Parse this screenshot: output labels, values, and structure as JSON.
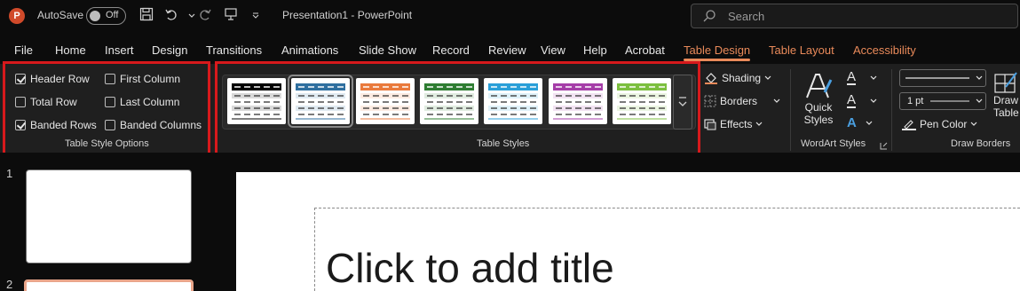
{
  "titlebar": {
    "app_logo": "P",
    "autosave_label": "AutoSave",
    "autosave_state": "Off",
    "doc_title": "Presentation1  -  PowerPoint",
    "search_placeholder": "Search"
  },
  "tabs": [
    {
      "label": "File"
    },
    {
      "label": "Home"
    },
    {
      "label": "Insert"
    },
    {
      "label": "Design"
    },
    {
      "label": "Transitions"
    },
    {
      "label": "Animations"
    },
    {
      "label": "Slide Show"
    },
    {
      "label": "Record"
    },
    {
      "label": "Review"
    },
    {
      "label": "View"
    },
    {
      "label": "Help"
    },
    {
      "label": "Acrobat"
    },
    {
      "label": "Table Design"
    },
    {
      "label": "Table Layout"
    },
    {
      "label": "Accessibility"
    }
  ],
  "table_style_options": {
    "caption": "Table Style Options",
    "options": [
      {
        "label": "Header Row",
        "checked": true
      },
      {
        "label": "First Column",
        "checked": false
      },
      {
        "label": "Total Row",
        "checked": false
      },
      {
        "label": "Last Column",
        "checked": false
      },
      {
        "label": "Banded Rows",
        "checked": true
      },
      {
        "label": "Banded Columns",
        "checked": false
      }
    ]
  },
  "table_styles": {
    "caption": "Table Styles",
    "styles": [
      {
        "accent": "#000000",
        "selected": false
      },
      {
        "accent": "#2f6f9f",
        "selected": true
      },
      {
        "accent": "#e97a3c",
        "selected": false
      },
      {
        "accent": "#2e7d32",
        "selected": false
      },
      {
        "accent": "#2a9fd8",
        "selected": false
      },
      {
        "accent": "#a53ea8",
        "selected": false
      },
      {
        "accent": "#7cbf3f",
        "selected": false
      }
    ]
  },
  "table_style_commands": {
    "shading": "Shading",
    "borders": "Borders",
    "effects": "Effects"
  },
  "wordart": {
    "caption": "WordArt Styles",
    "quick_styles_line1": "Quick",
    "quick_styles_line2": "Styles",
    "glyph": "A"
  },
  "draw_borders": {
    "caption": "Draw Borders",
    "pen_weight": "1 pt",
    "pen_color": "Pen Color",
    "draw_table_line1": "Draw",
    "draw_table_line2": "Table"
  },
  "slides": {
    "numbers": [
      "1",
      "2"
    ],
    "title_placeholder": "Click to add title"
  }
}
